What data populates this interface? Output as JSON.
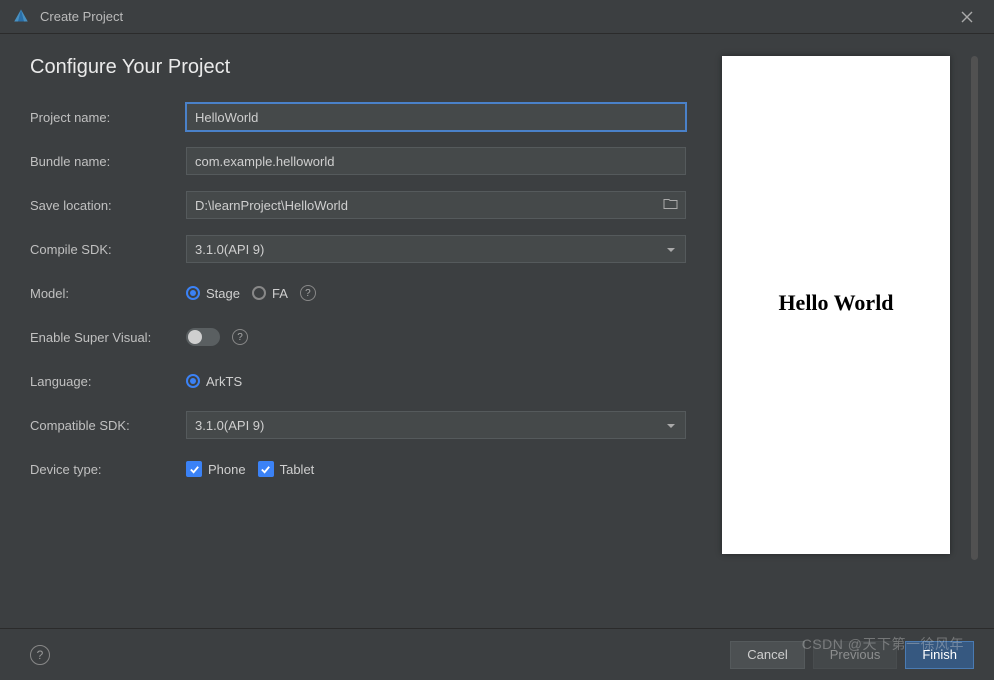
{
  "titlebar": {
    "title": "Create Project"
  },
  "heading": "Configure Your Project",
  "labels": {
    "projectName": "Project name:",
    "bundleName": "Bundle name:",
    "saveLocation": "Save location:",
    "compileSdk": "Compile SDK:",
    "model": "Model:",
    "enableSuperVisual": "Enable Super Visual:",
    "language": "Language:",
    "compatibleSdk": "Compatible SDK:",
    "deviceType": "Device type:"
  },
  "fields": {
    "projectName": "HelloWorld",
    "bundleName": "com.example.helloworld",
    "saveLocation": "D:\\learnProject\\HelloWorld",
    "compileSdk": "3.1.0(API 9)",
    "compatibleSdk": "3.1.0(API 9)"
  },
  "model": {
    "options": {
      "stage": "Stage",
      "fa": "FA"
    },
    "selected": "stage"
  },
  "enableSuperVisual": false,
  "language": {
    "arkts": "ArkTS"
  },
  "deviceType": {
    "phone": "Phone",
    "tablet": "Tablet",
    "phoneChecked": true,
    "tabletChecked": true
  },
  "preview": {
    "text": "Hello World"
  },
  "footer": {
    "cancel": "Cancel",
    "previous": "Previous",
    "finish": "Finish"
  },
  "watermark": "CSDN @天下第一徐风年"
}
